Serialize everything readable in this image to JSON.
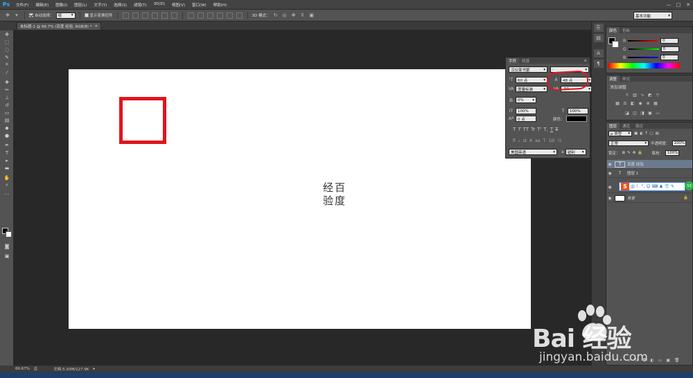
{
  "app": {
    "logo": "Ps"
  },
  "menu": [
    "文件(F)",
    "编辑(E)",
    "图像(I)",
    "图层(L)",
    "文字(Y)",
    "选择(S)",
    "滤镜(T)",
    "3D(D)",
    "视图(V)",
    "窗口(W)",
    "帮助(H)"
  ],
  "window_controls": [
    "—",
    "□",
    "✕"
  ],
  "options": {
    "auto_select_label": "自动选择：",
    "auto_select_value": "组",
    "show_transform_label": "显示变换控件",
    "mode_3d_label": "3D 模式：",
    "workspace": "基本功能"
  },
  "doc_tab": {
    "title": "未标题-1 @ 66.7% (百度 经验, RGB/8) *",
    "close": "×"
  },
  "canvas": {
    "seal_col_right": [
      "百",
      "度"
    ],
    "seal_col_left": [
      "经",
      "验"
    ],
    "square_color": "#e1141d"
  },
  "status": {
    "zoom": "66.67%",
    "doc": "文档:5.93M/127.9K",
    "arrow": "▸"
  },
  "char_panel": {
    "tabs": [
      "字符",
      "段落"
    ],
    "font_family": "汉仪篆书繁",
    "font_style": "-",
    "font_size": "60 点",
    "leading": "48 点",
    "kerning": "度量标准",
    "tracking": "-50",
    "tsume": "0%",
    "vscale": "100%",
    "hscale": "100%",
    "baseline": "0 点",
    "color_label": "颜色：",
    "styles": [
      "T",
      "T",
      "TT",
      "Tr",
      "T'",
      "T,",
      "T",
      "T"
    ],
    "opentype": [
      "fi",
      "ℴ",
      "st",
      "A",
      "aa",
      "T",
      "1st",
      "½"
    ],
    "language": "美国英语",
    "aa": "a",
    "aa_mode": "锐利"
  },
  "color_panel": {
    "tabs": [
      "颜色",
      "色板"
    ],
    "r_label": "R",
    "g_label": "G",
    "b_label": "B",
    "r": "0",
    "g": "0",
    "b": "0"
  },
  "adjust_panel": {
    "tabs": [
      "调整",
      "样式"
    ],
    "title": "添加调整"
  },
  "layers_panel": {
    "tabs": [
      "图层",
      "通道",
      "路径"
    ],
    "filter": "ρ 类型",
    "blend": "正常",
    "opacity_label": "不透明度：",
    "opacity": "100%",
    "lock_label": "锁定：",
    "fill_label": "填充：",
    "fill": "100%",
    "layers": [
      {
        "name": "百度 经验",
        "thumb": "T",
        "selected": true
      },
      {
        "name": "图层 1",
        "thumb": "T",
        "selected": false
      },
      {
        "name": "",
        "thumb": "",
        "selected": false
      },
      {
        "name": "背景",
        "thumb": "",
        "selected": false
      }
    ]
  },
  "ime": {
    "logo": "S",
    "text": "中",
    "badge": "53"
  },
  "watermark": {
    "logo": "Bai  经验",
    "sub": "jingyan.baidu.com"
  }
}
